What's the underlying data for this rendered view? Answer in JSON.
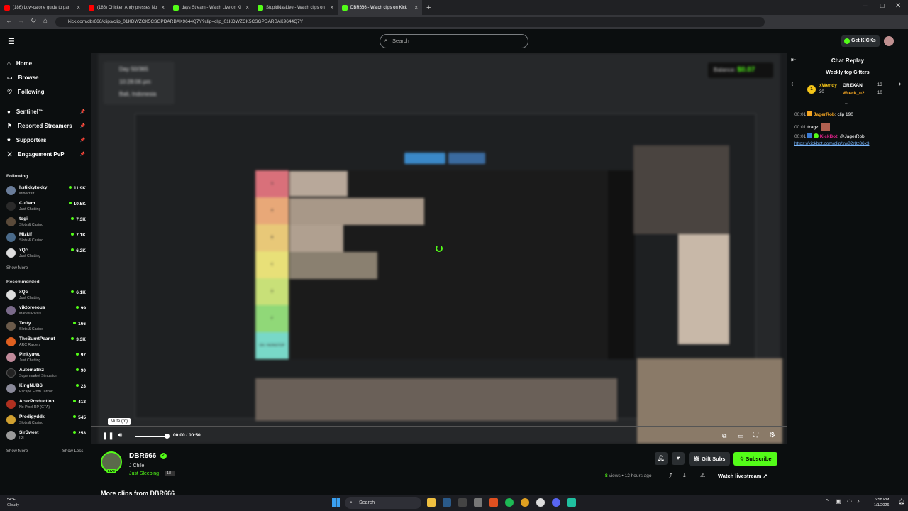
{
  "browser": {
    "tabs": [
      {
        "title": "(186) Low-calorie guide to pan",
        "color": "#ff0000"
      },
      {
        "title": "(186) Chicken Andy presses No",
        "color": "#ff0000"
      },
      {
        "title": "days Stream - Watch Live on Ki",
        "color": "#53fc18"
      },
      {
        "title": "StupidNasLive - Watch clips on",
        "color": "#53fc18"
      },
      {
        "title": "DBR666 - Watch clips on Kick",
        "color": "#53fc18"
      }
    ],
    "url": "kick.com/dbr666/clips/clip_01KDWZCK5CSGPDARBAK9644Q7Y?clip=clip_01KDWZCK5CSGPDARBAK9644Q7Y"
  },
  "header": {
    "search_placeholder": "Search",
    "get_kicks": "Get KICKs"
  },
  "sidebar": {
    "nav": [
      {
        "label": "Home",
        "icon": "home-icon"
      },
      {
        "label": "Browse",
        "icon": "browse-icon"
      },
      {
        "label": "Following",
        "icon": "heart-icon"
      }
    ],
    "extras": [
      {
        "label": "Sentinel™"
      },
      {
        "label": "Reported Streamers"
      },
      {
        "label": "Supporters"
      },
      {
        "label": "Engagement PvP"
      }
    ],
    "following_title": "Following",
    "following": [
      {
        "name": "hstikkytokky",
        "category": "Minecraft",
        "viewers": "11.9K",
        "color": "#6a7d9a"
      },
      {
        "name": "Cuffem",
        "category": "Just Chatting",
        "viewers": "10.5K",
        "color": "#2a2a2a"
      },
      {
        "name": "togi",
        "category": "Slots & Casino",
        "viewers": "7.3K",
        "color": "#5a4a3a"
      },
      {
        "name": "Mizkif",
        "category": "Slots & Casino",
        "viewers": "7.1K",
        "color": "#4a6a8a"
      },
      {
        "name": "xQc",
        "category": "Just Chatting",
        "viewers": "6.2K",
        "color": "#dddddd"
      }
    ],
    "show_more_1": "Show More",
    "recommended_title": "Recommended",
    "recommended": [
      {
        "name": "xQc",
        "category": "Just Chatting",
        "viewers": "6.1K",
        "color": "#dddddd"
      },
      {
        "name": "viktoreeous",
        "category": "Marvel Rivals",
        "viewers": "99",
        "color": "#7a6a8a"
      },
      {
        "name": "Testy",
        "category": "Slots & Casino",
        "viewers": "166",
        "color": "#6a5a4a"
      },
      {
        "name": "TheBurntPeanut",
        "category": "ARC Raiders",
        "viewers": "3.3K",
        "color": "#e06020"
      },
      {
        "name": "Pinkyuwu",
        "category": "Just Chatting",
        "viewers": "97",
        "color": "#c08a9a"
      },
      {
        "name": "Automatikz",
        "category": "Supermarket Simulator",
        "viewers": "90",
        "color": "#222222"
      },
      {
        "name": "KingNUBS",
        "category": "Escape From Tarkov",
        "viewers": "23",
        "color": "#8a8a9a"
      },
      {
        "name": "AcezProduction",
        "category": "No Pixel RP (GTA)",
        "viewers": "413",
        "color": "#b03020"
      },
      {
        "name": "Prodigyddk",
        "category": "Slots & Casino",
        "viewers": "545",
        "color": "#d0a030"
      },
      {
        "name": "SirSweet",
        "category": "IRL",
        "viewers": "253",
        "color": "#9a9a9a"
      }
    ],
    "show_more_2": "Show More",
    "show_less": "Show Less"
  },
  "video": {
    "overlay_day": "Day 50/365",
    "overlay_time": "10:28:06 pm",
    "overlay_loc": "Bali, Indonesia",
    "balance_label": "Balance:",
    "balance_value": "$0.07",
    "tier_labels": [
      "S",
      "A",
      "B",
      "C",
      "D",
      "F",
      "OK / NONSTOP"
    ],
    "tooltip": "Mute (m)",
    "time": "00:00 / 00:50"
  },
  "channel": {
    "name": "DBR666",
    "title": "J Chile",
    "category": "Just Sleeping",
    "age": "18+",
    "live_badge": "LIVE",
    "views_count": "8",
    "views_rest": "views • 12 hours ago",
    "gift_subs": "Gift Subs",
    "subscribe": "Subscribe",
    "watch_livestream": "Watch livestream",
    "more_clips": "More clips from DBR666"
  },
  "chat": {
    "title": "Chat Replay",
    "gifters_title": "Weekly top Gifters",
    "gifters": [
      {
        "name": "xWendy",
        "count": "30",
        "color": "#f5c518"
      },
      {
        "name": "GREXAN",
        "count": "13",
        "color": "#ffffff"
      },
      {
        "name": "Wreck_u2",
        "count": "10",
        "color": "#f5a623"
      }
    ],
    "messages": [
      {
        "time": "00:01",
        "user": "JagerRob",
        "user_color": "#f5a623",
        "text": ": clip 190"
      },
      {
        "time": "00:01",
        "user": "tragz",
        "user_color": "#cccccc",
        "text": ":"
      },
      {
        "time": "00:01",
        "user": "KickBot",
        "user_color": "#e0218a",
        "text": ": @JagerRob"
      }
    ],
    "link": "https://kickbot.com/clip/xw82r8z86x3"
  },
  "taskbar": {
    "weather_temp": "54°F",
    "weather_desc": "Cloudy",
    "search": "Search",
    "clock_time": "6:58 PM",
    "clock_date": "1/1/2026"
  }
}
